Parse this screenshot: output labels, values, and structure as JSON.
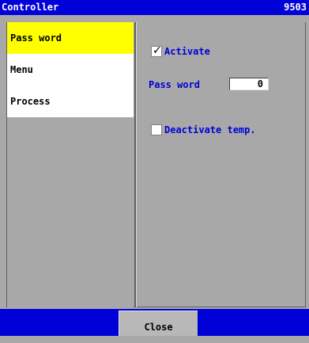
{
  "window": {
    "title": "Controller",
    "code": "9503"
  },
  "menu": {
    "items": [
      {
        "label": "Pass word",
        "selected": true
      },
      {
        "label": "Menu",
        "selected": false
      },
      {
        "label": "Process",
        "selected": false
      }
    ]
  },
  "settings": {
    "activate": {
      "label": "Activate",
      "checked": true
    },
    "password": {
      "label": "Pass word",
      "value": "0"
    },
    "deactivate": {
      "label": "Deactivate temp.",
      "checked": false
    }
  },
  "footer": {
    "close_label": "Close"
  },
  "colors": {
    "titlebar": "#0000d8",
    "selected_item": "#ffff00",
    "label_text": "#0000d8"
  }
}
